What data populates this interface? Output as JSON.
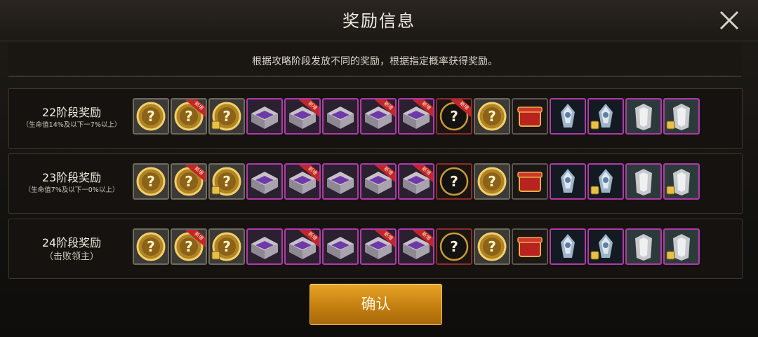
{
  "dialog": {
    "title": "奖励信息",
    "description": "根据攻略阶段发放不同的奖励，根据指定概率获得奖励。",
    "confirm_label": "确认",
    "new_badge": "新增"
  },
  "stages": [
    {
      "title": "22阶段奖励",
      "subtitle": "（生命值14%及以下一7%以上）"
    },
    {
      "title": "23阶段奖励",
      "subtitle": "（生命值7%及以下一0%以上）"
    },
    {
      "title": "24阶段奖励",
      "subtitle": "（击败领主）"
    }
  ]
}
